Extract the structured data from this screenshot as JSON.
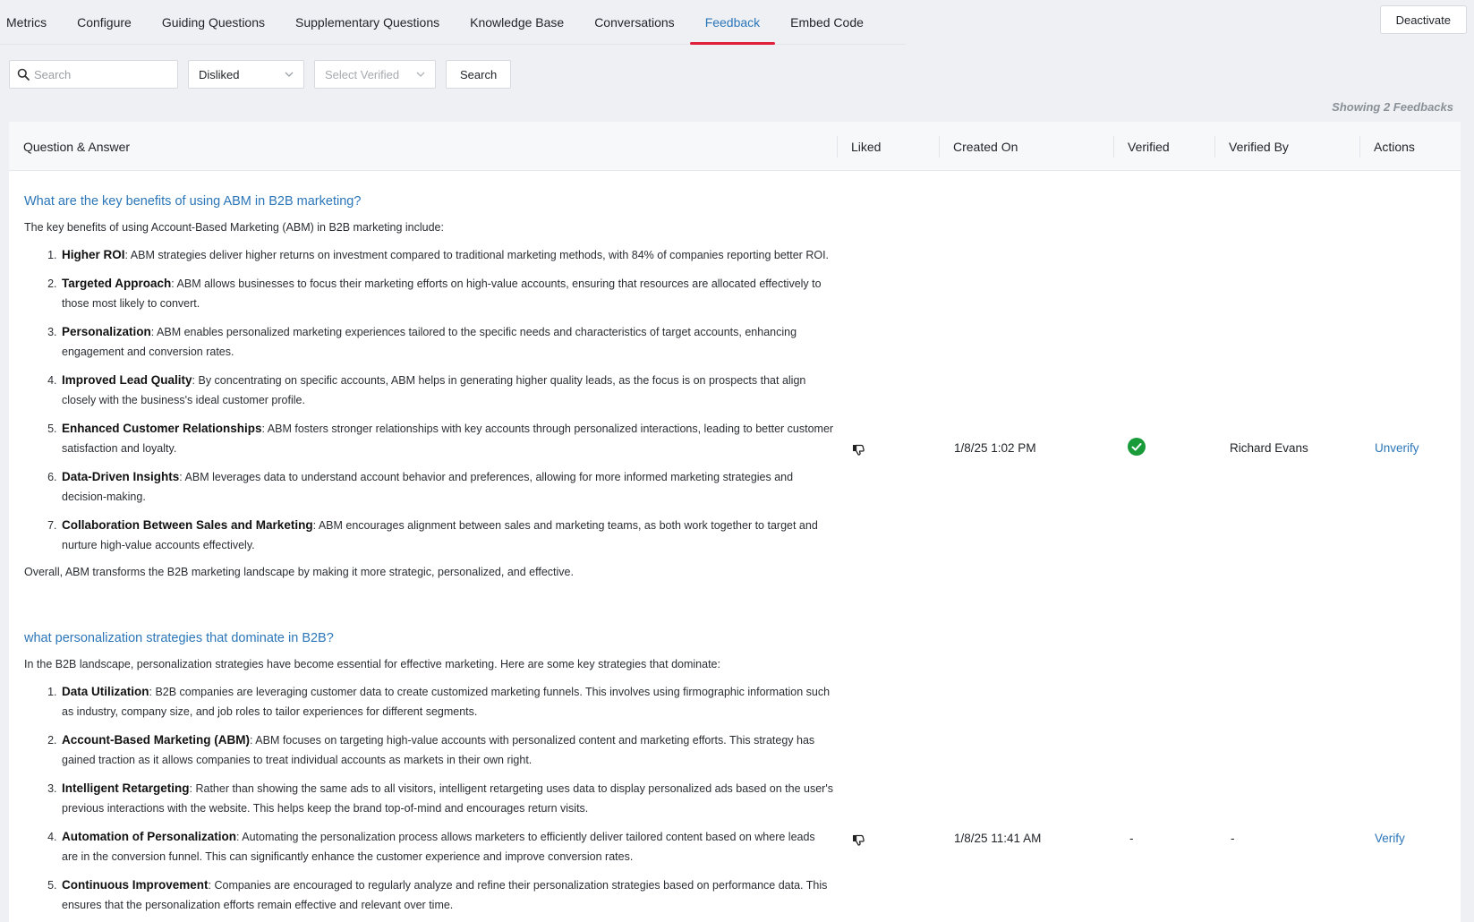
{
  "tabs": [
    {
      "label": "Metrics",
      "active": false
    },
    {
      "label": "Configure",
      "active": false
    },
    {
      "label": "Guiding Questions",
      "active": false
    },
    {
      "label": "Supplementary Questions",
      "active": false
    },
    {
      "label": "Knowledge Base",
      "active": false
    },
    {
      "label": "Conversations",
      "active": false
    },
    {
      "label": "Feedback",
      "active": true
    },
    {
      "label": "Embed Code",
      "active": false
    }
  ],
  "header": {
    "deactivate_label": "Deactivate"
  },
  "filters": {
    "search_placeholder": "Search",
    "liked_filter": "Disliked",
    "verified_placeholder": "Select Verified",
    "search_button": "Search"
  },
  "showing_text": "Showing 2 Feedbacks",
  "columns": {
    "qa": "Question & Answer",
    "liked": "Liked",
    "created": "Created On",
    "verified": "Verified",
    "verified_by": "Verified By",
    "actions": "Actions"
  },
  "rows": [
    {
      "question": "What are the key benefits of using ABM in B2B marketing?",
      "intro": "The key benefits of using Account-Based Marketing (ABM) in B2B marketing include:",
      "items": [
        {
          "title": "Higher ROI",
          "text": ": ABM strategies deliver higher returns on investment compared to traditional marketing methods, with 84% of companies reporting better ROI."
        },
        {
          "title": "Targeted Approach",
          "text": ": ABM allows businesses to focus their marketing efforts on high-value accounts, ensuring that resources are allocated effectively to those most likely to convert."
        },
        {
          "title": "Personalization",
          "text": ": ABM enables personalized marketing experiences tailored to the specific needs and characteristics of target accounts, enhancing engagement and conversion rates."
        },
        {
          "title": "Improved Lead Quality",
          "text": ": By concentrating on specific accounts, ABM helps in generating higher quality leads, as the focus is on prospects that align closely with the business's ideal customer profile."
        },
        {
          "title": "Enhanced Customer Relationships",
          "text": ": ABM fosters stronger relationships with key accounts through personalized interactions, leading to better customer satisfaction and loyalty."
        },
        {
          "title": "Data-Driven Insights",
          "text": ": ABM leverages data to understand account behavior and preferences, allowing for more informed marketing strategies and decision-making."
        },
        {
          "title": "Collaboration Between Sales and Marketing",
          "text": ": ABM encourages alignment between sales and marketing teams, as both work together to target and nurture high-value accounts effectively."
        }
      ],
      "outro": "Overall, ABM transforms the B2B marketing landscape by making it more strategic, personalized, and effective.",
      "liked_icon": "thumbs-down-icon",
      "created_on": "1/8/25 1:02 PM",
      "verified": true,
      "verified_text": "",
      "verified_by": "Richard Evans",
      "action": "Unverify"
    },
    {
      "question": "what personalization strategies that dominate in B2B?",
      "intro": "In the B2B landscape, personalization strategies have become essential for effective marketing. Here are some key strategies that dominate:",
      "items": [
        {
          "title": "Data Utilization",
          "text": ": B2B companies are leveraging customer data to create customized marketing funnels. This involves using firmographic information such as industry, company size, and job roles to tailor experiences for different segments."
        },
        {
          "title": "Account-Based Marketing (ABM)",
          "text": ": ABM focuses on targeting high-value accounts with personalized content and marketing efforts. This strategy has gained traction as it allows companies to treat individual accounts as markets in their own right."
        },
        {
          "title": "Intelligent Retargeting",
          "text": ": Rather than showing the same ads to all visitors, intelligent retargeting uses data to display personalized ads based on the user's previous interactions with the website. This helps keep the brand top-of-mind and encourages return visits."
        },
        {
          "title": "Automation of Personalization",
          "text": ": Automating the personalization process allows marketers to efficiently deliver tailored content based on where leads are in the conversion funnel. This can significantly enhance the customer experience and improve conversion rates."
        },
        {
          "title": "Continuous Improvement",
          "text": ": Companies are encouraged to regularly analyze and refine their personalization strategies based on performance data. This ensures that the personalization efforts remain effective and relevant over time."
        }
      ],
      "outro": "",
      "liked_icon": "thumbs-down-icon",
      "created_on": "1/8/25 11:41 AM",
      "verified": false,
      "verified_text": "-",
      "verified_by": "-",
      "action": "Verify"
    }
  ],
  "colors": {
    "accent": "#2b76b8",
    "active_underline": "#e0203a",
    "verified_green": "#1a9b3a"
  }
}
